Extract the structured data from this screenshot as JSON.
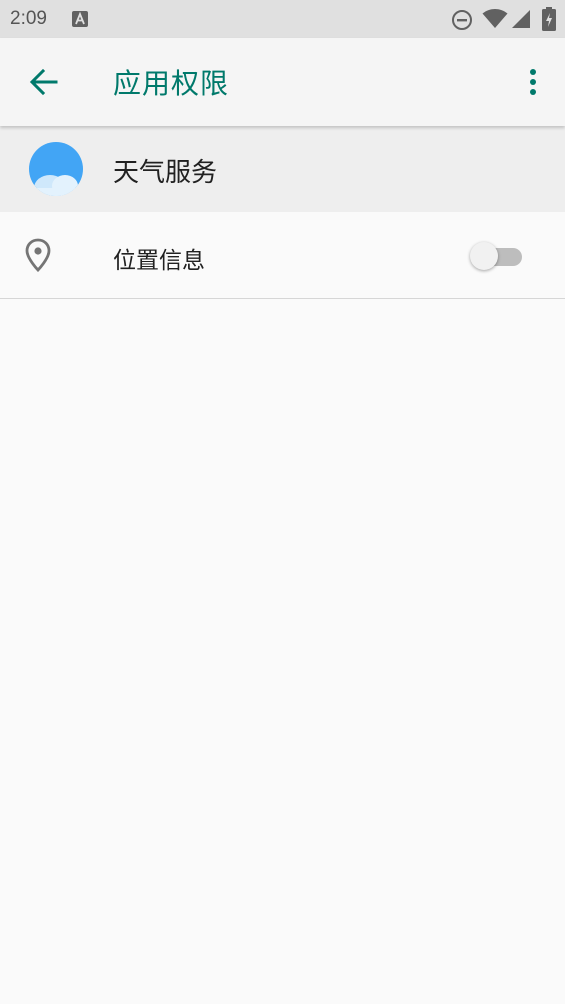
{
  "status_bar": {
    "time": "2:09",
    "icons": [
      "notification-a-icon",
      "do-not-disturb-icon",
      "wifi-icon",
      "signal-icon",
      "battery-charging-icon"
    ]
  },
  "app_bar": {
    "title": "应用权限",
    "back_icon": "arrow-back-icon",
    "menu_icon": "more-vert-icon"
  },
  "app": {
    "name": "天气服务",
    "icon": "weather-cloud-icon"
  },
  "permissions": [
    {
      "label": "位置信息",
      "icon": "location-pin-icon",
      "enabled": false
    }
  ],
  "colors": {
    "accent": "#00796b",
    "status_bar_bg": "#e0e0e0",
    "app_bar_bg": "#f5f5f5",
    "app_header_bg": "#eeeeee",
    "page_bg": "#fafafa",
    "app_icon_blue": "#42a5f5"
  }
}
